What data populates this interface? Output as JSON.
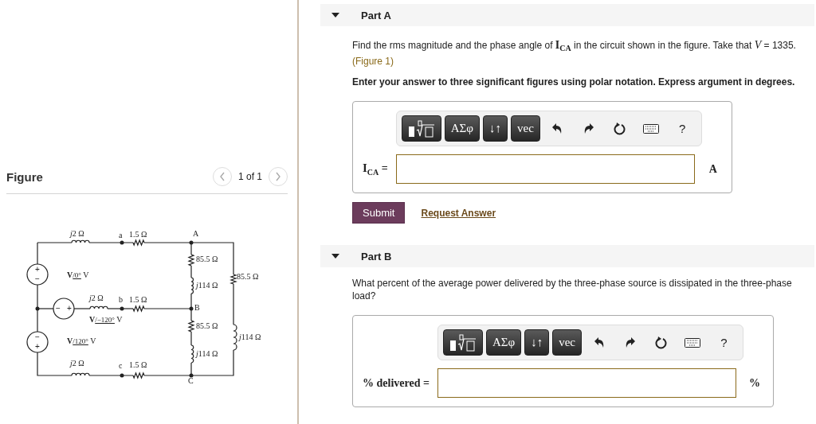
{
  "figure": {
    "title": "Figure",
    "pager": "1 of 1",
    "prev_disabled": true,
    "next_disabled": true,
    "circuit": {
      "sources": [
        {
          "signs": [
            "+",
            "−"
          ]
        },
        {
          "signs": [
            "−",
            "+"
          ]
        },
        {
          "signs": [
            "−",
            "+"
          ]
        }
      ],
      "labels": [
        {
          "kind": "impedance",
          "imag": "j",
          "value": "2 Ω"
        },
        {
          "kind": "plain",
          "text": "a"
        },
        {
          "kind": "plain",
          "text": "1.5 Ω"
        },
        {
          "kind": "plain",
          "text": "A"
        },
        {
          "kind": "plain",
          "text": "85.5 Ω"
        },
        {
          "kind": "phasor",
          "symbol": "V",
          "angle": "/0°",
          "unit": "V"
        },
        {
          "kind": "impedance",
          "imag": "j",
          "value": "114 Ω"
        },
        {
          "kind": "plain",
          "text": "85.5 Ω"
        },
        {
          "kind": "impedance",
          "imag": "j",
          "value": "2 Ω"
        },
        {
          "kind": "plain",
          "text": "b"
        },
        {
          "kind": "plain",
          "text": "1.5 Ω"
        },
        {
          "kind": "plain",
          "text": "B"
        },
        {
          "kind": "phasor",
          "symbol": "V",
          "angle": "/−120°",
          "unit": "V"
        },
        {
          "kind": "plain",
          "text": "85.5 Ω"
        },
        {
          "kind": "impedance",
          "imag": "j",
          "value": "114 Ω"
        },
        {
          "kind": "phasor",
          "symbol": "V",
          "angle": "/120°",
          "unit": "V"
        },
        {
          "kind": "impedance",
          "imag": "j",
          "value": "114 Ω"
        },
        {
          "kind": "impedance",
          "imag": "j",
          "value": "2 Ω"
        },
        {
          "kind": "plain",
          "text": "c"
        },
        {
          "kind": "plain",
          "text": "1.5 Ω"
        },
        {
          "kind": "plain",
          "text": "C"
        }
      ]
    }
  },
  "parts": [
    {
      "title": "Part A",
      "expanded": true,
      "question": "Find the rms magnitude and the phase angle of **I**$_{CA}$ in the circuit shown in the figure. Take that *V* = 1335.",
      "figure_link": "(Figure 1)",
      "instruction": "Enter your answer to three significant figures using polar notation. Express argument in degrees.",
      "toolbar": [
        {
          "kind": "templates"
        },
        {
          "kind": "text",
          "text": "ΑΣφ"
        },
        {
          "kind": "text",
          "text": "↓↑"
        },
        {
          "kind": "text",
          "text": "vec"
        },
        {
          "kind": "undo"
        },
        {
          "kind": "redo"
        },
        {
          "kind": "reset"
        },
        {
          "kind": "keyboard"
        },
        {
          "kind": "help",
          "text": "?"
        }
      ],
      "answer_label": "**I**$_{CA}$ =",
      "unit": "A",
      "submit": "Submit",
      "request": "Request Answer"
    },
    {
      "title": "Part B",
      "expanded": true,
      "question": "What percent of the average power delivered by the three-phase source is dissipated in the three-phase load?",
      "toolbar": [
        {
          "kind": "templates"
        },
        {
          "kind": "text",
          "text": "ΑΣφ"
        },
        {
          "kind": "text",
          "text": "↓↑"
        },
        {
          "kind": "text",
          "text": "vec"
        },
        {
          "kind": "undo"
        },
        {
          "kind": "redo"
        },
        {
          "kind": "reset"
        },
        {
          "kind": "keyboard"
        },
        {
          "kind": "help",
          "text": "?"
        }
      ],
      "answer_label": "% delivered =",
      "unit": "%"
    }
  ]
}
